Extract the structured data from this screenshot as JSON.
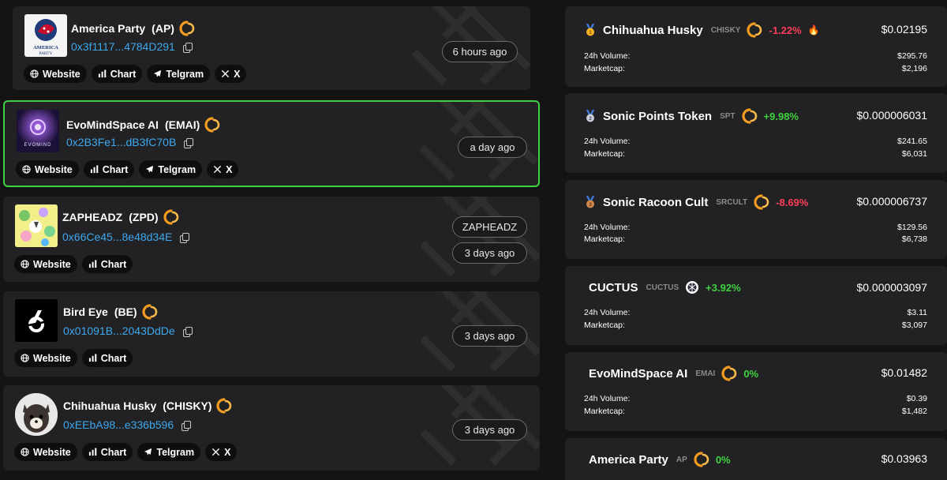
{
  "tokens": [
    {
      "name": "America Party",
      "symbol": "(AP)",
      "address": "0x3f1117...4784D291",
      "logo_text": "AMERICA PARTY",
      "time": "6 hours ago",
      "links": [
        "Website",
        "Chart",
        "Telgram",
        "X"
      ]
    },
    {
      "name": "EvoMindSpace AI",
      "symbol": "(EMAI)",
      "address": "0x2B3Fe1...dB3fC70B",
      "logo_text": "EVOMIND",
      "time": "a day ago",
      "links": [
        "Website",
        "Chart",
        "Telgram",
        "X"
      ]
    },
    {
      "name": "ZAPHEADZ",
      "symbol": "(ZPD)",
      "address": "0x66Ce45...8e48d34E",
      "tag": "ZAPHEADZ",
      "time": "3 days ago",
      "links": [
        "Website",
        "Chart"
      ]
    },
    {
      "name": "Bird Eye",
      "symbol": "(BE)",
      "address": "0x01091B...2043DdDe",
      "time": "3 days ago",
      "links": [
        "Website",
        "Chart"
      ]
    },
    {
      "name": "Chihuahua Husky",
      "symbol": "(CHISKY)",
      "address": "0xEEbA98...e336b596",
      "time": "3 days ago",
      "links": [
        "Website",
        "Chart",
        "Telgram",
        "X"
      ]
    }
  ],
  "stats": [
    {
      "title": "Chihuahua Husky",
      "ticker": "CHISKY",
      "change": "-1.22%",
      "direction": "down",
      "fire": "🔥",
      "price": "$0.02195",
      "volume_label": "24h Volume:",
      "volume": "$295.76",
      "mcap_label": "Marketcap:",
      "mcap": "$2,196",
      "medal": "gold"
    },
    {
      "title": "Sonic Points Token",
      "ticker": "SPT",
      "change": "+9.98%",
      "direction": "up",
      "price": "$0.000006031",
      "volume_label": "24h Volume:",
      "volume": "$241.65",
      "mcap_label": "Marketcap:",
      "mcap": "$6,031",
      "medal": "silver"
    },
    {
      "title": "Sonic Racoon Cult",
      "ticker": "SRCULT",
      "change": "-8.69%",
      "direction": "down",
      "price": "$0.000006737",
      "volume_label": "24h Volume:",
      "volume": "$129.56",
      "mcap_label": "Marketcap:",
      "mcap": "$6,738",
      "medal": "bronze"
    },
    {
      "title": "CUCTUS",
      "ticker": "CUCTUS",
      "change": "+3.92%",
      "direction": "up",
      "price": "$0.000003097",
      "volume_label": "24h Volume:",
      "volume": "$3.11",
      "mcap_label": "Marketcap:",
      "mcap": "$3,097"
    },
    {
      "title": "EvoMindSpace AI",
      "ticker": "EMAI",
      "change": "0%",
      "direction": "up",
      "price": "$0.01482",
      "volume_label": "24h Volume:",
      "volume": "$0.39",
      "mcap_label": "Marketcap:",
      "mcap": "$1,482"
    },
    {
      "title": "America Party",
      "ticker": "AP",
      "change": "0%",
      "direction": "up",
      "price": "$0.03963"
    }
  ],
  "colors": {
    "accent_green": "#3fd23f",
    "negative_red": "#ff3d5a",
    "address_blue": "#3ea8ee",
    "ring_orange": "#f39c1f"
  }
}
